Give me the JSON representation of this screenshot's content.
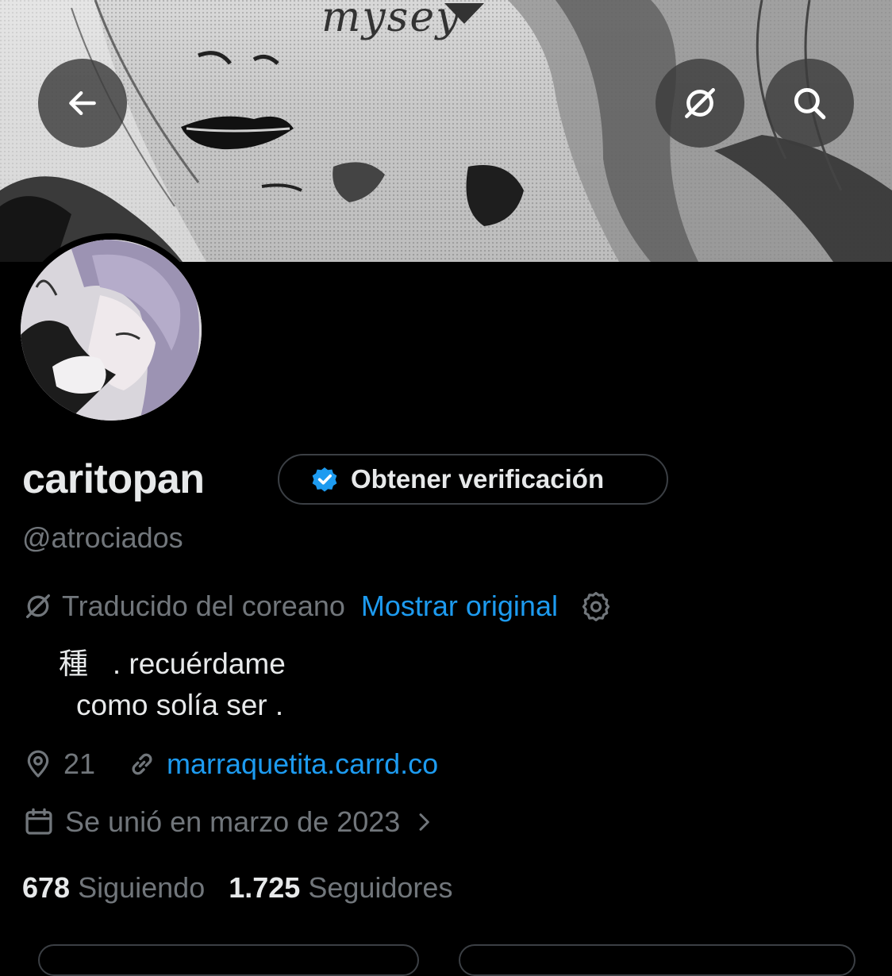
{
  "banner": {
    "word": "mysey"
  },
  "header": {
    "back_icon": "arrow-left-icon",
    "translate_icon": "translate-icon",
    "search_icon": "search-icon"
  },
  "profile": {
    "display_name": "caritopan",
    "handle": "@atrociados",
    "verify_button": "Obtener verificación",
    "translation": {
      "notice": "Traducido del coreano",
      "show_original": "Mostrar original"
    },
    "bio_line1": "種   . recuérdame",
    "bio_line2": "como solía ser .",
    "location": "21",
    "website": "marraquetita.carrd.co",
    "joined": "Se unió en marzo de 2023",
    "following_count": "678",
    "following_label": "Siguiendo",
    "followers_count": "1.725",
    "followers_label": "Seguidores"
  },
  "colors": {
    "background": "#000000",
    "text": "#e7e9ea",
    "muted": "#71767b",
    "accent": "#1d9bf0",
    "border": "#3b3f44"
  }
}
